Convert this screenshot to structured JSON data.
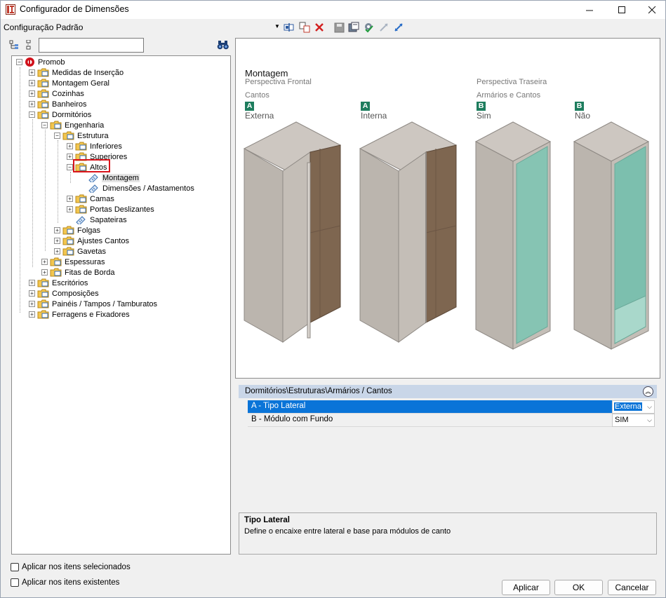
{
  "window": {
    "title": "Configurador de Dimensões"
  },
  "toolbar": {
    "config_name": "Configuração Padrão"
  },
  "tree": {
    "items": [
      {
        "label": "Promob"
      },
      {
        "label": "Medidas de Inserção"
      },
      {
        "label": "Montagem Geral"
      },
      {
        "label": "Cozinhas"
      },
      {
        "label": "Banheiros"
      },
      {
        "label": "Dormitórios"
      },
      {
        "label": "Engenharia"
      },
      {
        "label": "Estrutura"
      },
      {
        "label": "Inferiores"
      },
      {
        "label": "Superiores"
      },
      {
        "label": "Altos"
      },
      {
        "label": "Montagem"
      },
      {
        "label": "Dimensões / Afastamentos"
      },
      {
        "label": "Camas"
      },
      {
        "label": "Portas Deslizantes"
      },
      {
        "label": "Sapateiras"
      },
      {
        "label": "Folgas"
      },
      {
        "label": "Ajustes Cantos"
      },
      {
        "label": "Gavetas"
      },
      {
        "label": "Espessuras"
      },
      {
        "label": "Fitas de Borda"
      },
      {
        "label": "Escritórios"
      },
      {
        "label": "Composições"
      },
      {
        "label": "Painéis / Tampos / Tamburatos"
      },
      {
        "label": "Ferragens e Fixadores"
      }
    ]
  },
  "preview": {
    "title": "Montagem",
    "front_perspective": "Perspectiva Frontal",
    "back_perspective": "Perspectiva Traseira",
    "group_a": "Cantos",
    "group_b": "Armários e Cantos",
    "options": [
      {
        "letter": "A",
        "label": "Externa"
      },
      {
        "letter": "A",
        "label": "Interna"
      },
      {
        "letter": "B",
        "label": "Sim"
      },
      {
        "letter": "B",
        "label": "Não"
      }
    ],
    "accent_color": "#1e7d5e"
  },
  "properties": {
    "path": "Dormitórios\\Estruturas\\Armários / Cantos",
    "rows": [
      {
        "name": "A - Tipo Lateral",
        "value": "Externa"
      },
      {
        "name": "B - Módulo com Fundo",
        "value": "SIM"
      }
    ],
    "selected_color": "#0a74d8"
  },
  "description": {
    "title": "Tipo Lateral",
    "text": "Define o encaixe entre lateral e base para módulos de canto"
  },
  "options": {
    "apply_selected": "Aplicar nos itens selecionados",
    "apply_existing": "Aplicar nos itens existentes"
  },
  "buttons": {
    "apply": "Aplicar",
    "ok": "OK",
    "cancel": "Cancelar"
  }
}
